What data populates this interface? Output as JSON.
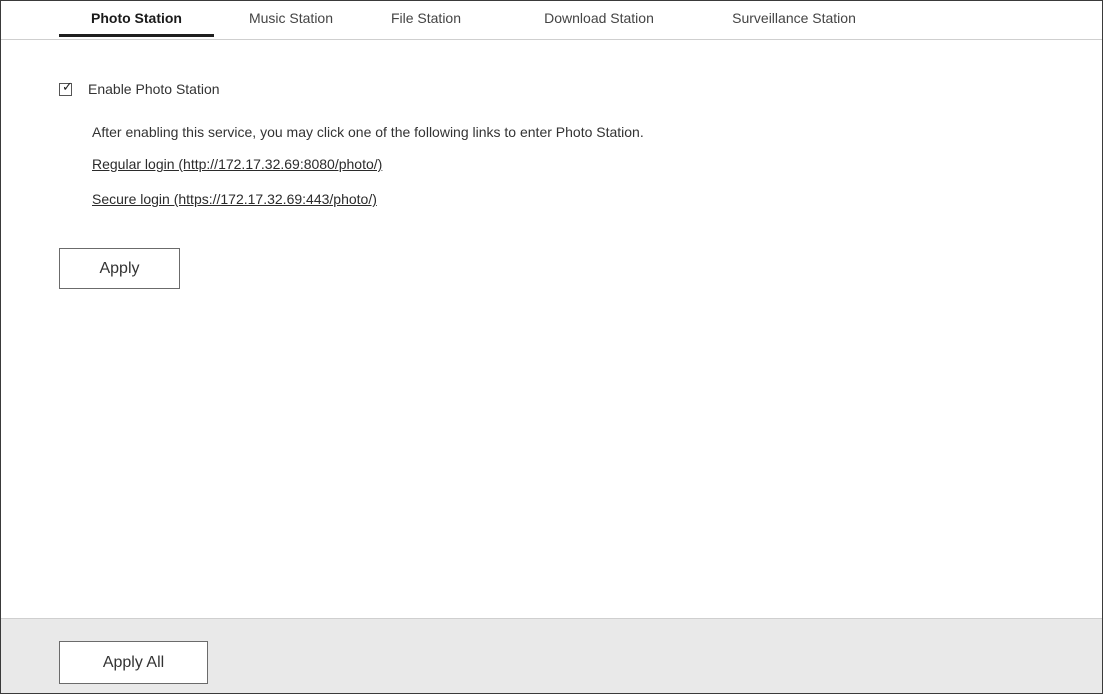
{
  "tabs": [
    {
      "label": "Photo Station",
      "active": true
    },
    {
      "label": "Music Station",
      "active": false
    },
    {
      "label": "File Station",
      "active": false
    },
    {
      "label": "Download Station",
      "active": false
    },
    {
      "label": "Surveillance Station",
      "active": false
    }
  ],
  "photo_station": {
    "enable_label": "Enable Photo Station",
    "enabled": true,
    "description": "After enabling this service, you may click one of the following links to enter Photo Station.",
    "regular_login": "Regular login (http://172.17.32.69:8080/photo/)",
    "secure_login": "Secure login (https://172.17.32.69:443/photo/)",
    "apply_label": "Apply"
  },
  "footer": {
    "apply_all_label": "Apply All"
  },
  "icons": {
    "checkbox": "checkbox-checked-icon"
  },
  "colors": {
    "footer_bg": "#e9e9e9",
    "active_tab_underline": "#1f1f1f",
    "border": "#3a3a3a"
  }
}
